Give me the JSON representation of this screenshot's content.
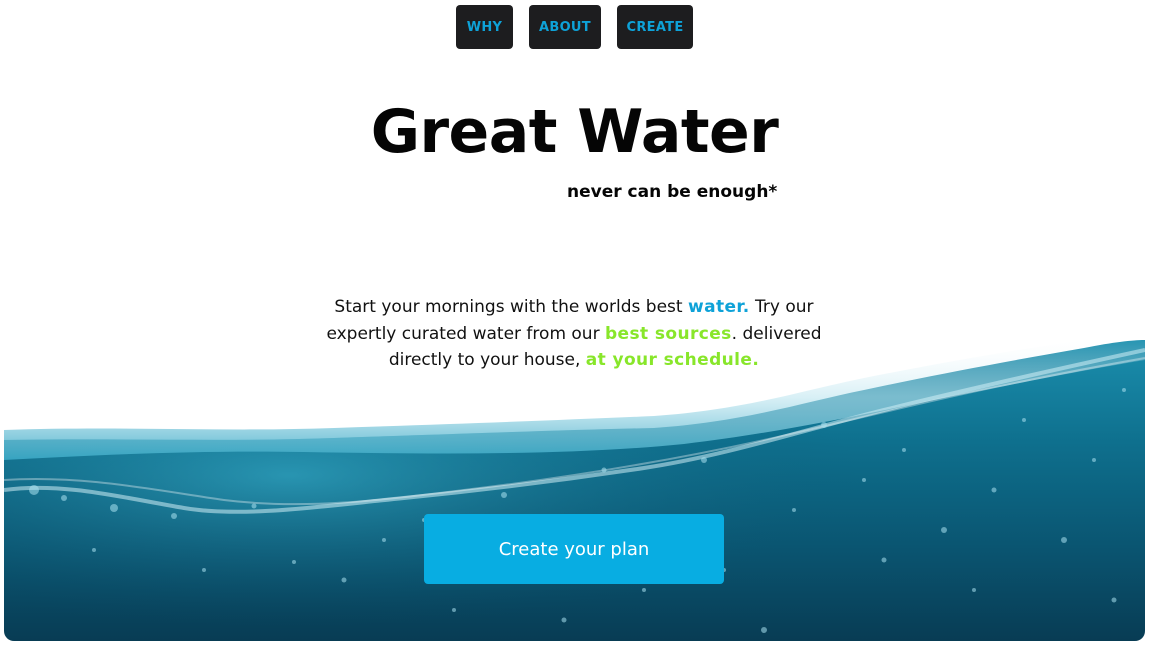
{
  "nav": {
    "items": [
      {
        "label": "WHY"
      },
      {
        "label": "ABOUT"
      },
      {
        "label": "CREATE"
      }
    ]
  },
  "hero": {
    "title": "Great Water",
    "subtitle": "never can be enough*"
  },
  "description": {
    "part1": "Start your mornings with the worlds best ",
    "highlight1": "water.",
    "part2": " Try our expertly curated water from our ",
    "highlight2": "best sources",
    "part3": ". delivered directly to your house, ",
    "highlight3": "at your schedule."
  },
  "cta": {
    "label": "Create your plan"
  },
  "colors": {
    "accent_blue": "#0ea2d8",
    "accent_green": "#88e62a",
    "nav_bg": "#1d1d1f",
    "cta_bg": "#08ade2",
    "water_deep": "#0a3b52",
    "water_surface": "#2a9cb8"
  }
}
